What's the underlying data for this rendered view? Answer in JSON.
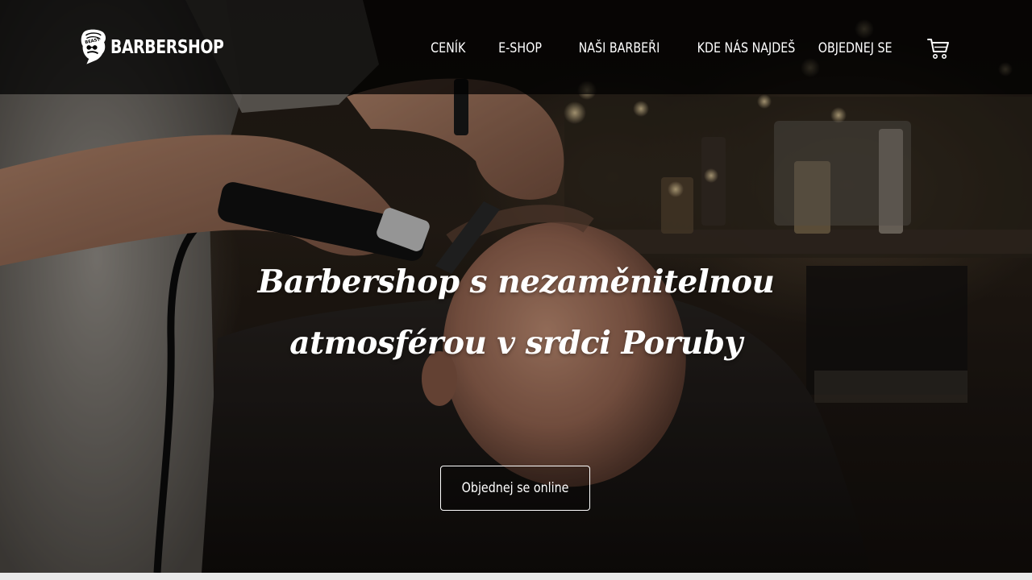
{
  "brand": {
    "logo_text": "BARBERSHOP",
    "logo_badge": "BEAST"
  },
  "nav": {
    "items": [
      {
        "label": "CENÍK"
      },
      {
        "label": "E-SHOP"
      },
      {
        "label": "NAŠI BARBEŘI"
      },
      {
        "label": "KDE NÁS NAJDEŠ"
      },
      {
        "label": "OBJEDNEJ SE"
      }
    ],
    "cart_icon": "shopping-cart-icon"
  },
  "hero": {
    "headline_line1": "Barbershop s nezaměnitelnou",
    "headline_line2": "atmosférou v srdci Poruby",
    "cta_label": "Objednej se online"
  },
  "colors": {
    "nav_background": "#000000",
    "text": "#ffffff",
    "page_background": "#e9e9e9"
  }
}
